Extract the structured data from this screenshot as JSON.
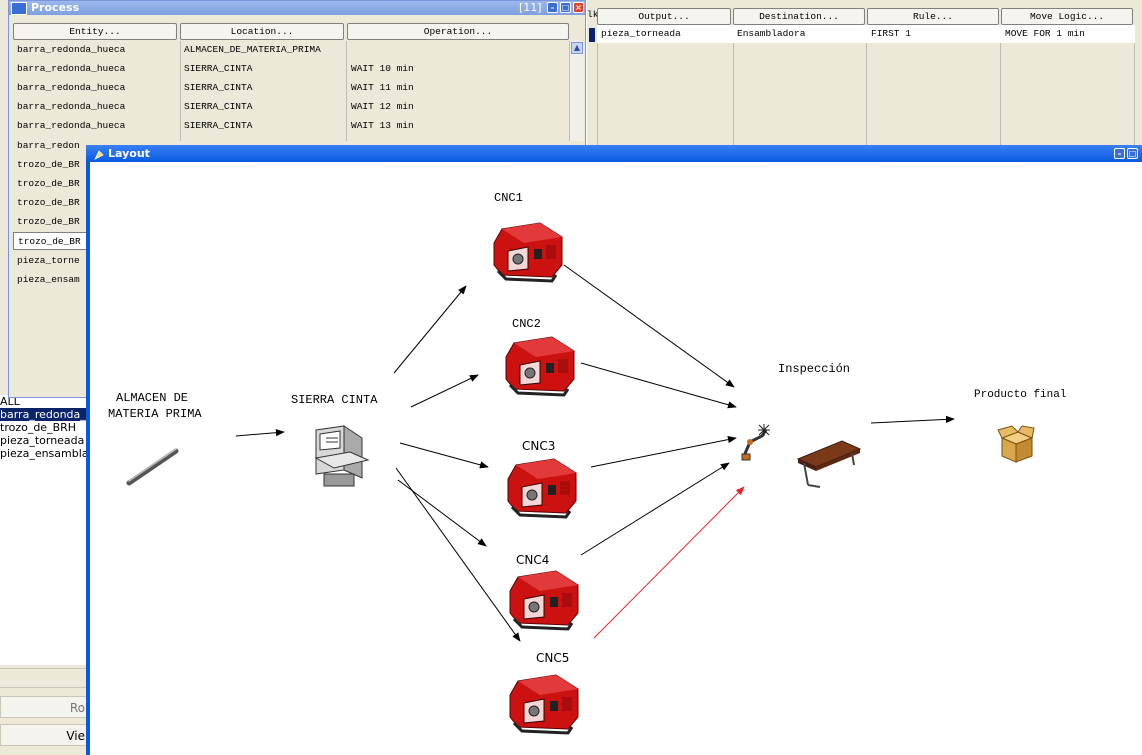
{
  "left_panel": {
    "list_items": [
      "ALL",
      "barra_redonda_hueca",
      "trozo_de_BRH",
      "pieza_torneada",
      "pieza_ensamblada"
    ],
    "buttons": [
      "Ro",
      "Vie"
    ]
  },
  "process_window": {
    "title": "Process",
    "counter": "[11]",
    "columns": [
      "Entity...",
      "Location...",
      "Operation..."
    ],
    "rows": [
      {
        "entity": "barra_redonda_hueca",
        "location": "ALMACEN_DE_MATERIA_PRIMA",
        "operation": ""
      },
      {
        "entity": "barra_redonda_hueca",
        "location": "SIERRA_CINTA",
        "operation": "WAIT 10 min"
      },
      {
        "entity": "barra_redonda_hueca",
        "location": "SIERRA_CINTA",
        "operation": "WAIT 11 min"
      },
      {
        "entity": "barra_redonda_hueca",
        "location": "SIERRA_CINTA",
        "operation": "WAIT 12 min"
      },
      {
        "entity": "barra_redonda_hueca",
        "location": "SIERRA_CINTA",
        "operation": "WAIT 13 min"
      },
      {
        "entity": "barra_redon",
        "location": "",
        "operation": ""
      },
      {
        "entity": "trozo_de_BR",
        "location": "",
        "operation": ""
      },
      {
        "entity": "trozo_de_BR",
        "location": "",
        "operation": ""
      },
      {
        "entity": "trozo_de_BR",
        "location": "",
        "operation": ""
      },
      {
        "entity": "trozo_de_BR",
        "location": "",
        "operation": ""
      },
      {
        "entity": "trozo_de_BR",
        "location": "",
        "operation": ""
      },
      {
        "entity": "pieza_torne",
        "location": "",
        "operation": ""
      },
      {
        "entity": "pieza_ensam",
        "location": "",
        "operation": ""
      }
    ]
  },
  "routing_table": {
    "blk_label": "lk",
    "columns": [
      "Output...",
      "Destination...",
      "Rule...",
      "Move Logic..."
    ],
    "rows": [
      {
        "output": "pieza_torneada",
        "destination": "Ensambladora",
        "rule": "FIRST 1",
        "move_logic": "MOVE FOR 1 min"
      }
    ]
  },
  "layout_window": {
    "title": "Layout",
    "labels": {
      "almacen_line1": "ALMACEN DE",
      "almacen_line2": "MATERIA PRIMA",
      "sierra": "SIERRA CINTA",
      "cnc1": "CNC1",
      "cnc2": "CNC2",
      "cnc3": "CNC3",
      "cnc4": "CNC4",
      "cnc5": "CNC5",
      "inspeccion": "Inspección",
      "producto_final": "Producto final"
    },
    "colors": {
      "cnc_red": "#cc1111",
      "path_black": "#000000",
      "path_red": "#ee2222",
      "table_brown": "#7a3a1a",
      "box_tan": "#d9a84a"
    }
  }
}
